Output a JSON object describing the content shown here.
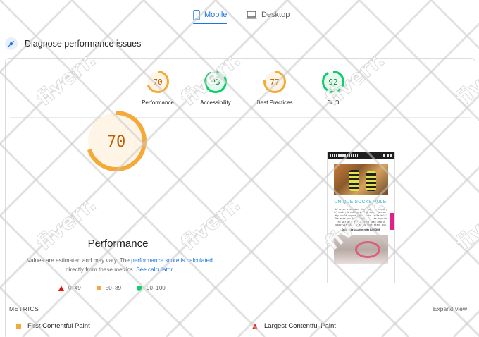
{
  "tabs": [
    {
      "label": "Mobile",
      "icon": "phone-icon",
      "active": true
    },
    {
      "label": "Desktop",
      "icon": "laptop-icon",
      "active": false
    }
  ],
  "diagnose": {
    "title": "Diagnose performance issues",
    "icon": "diagnose-icon"
  },
  "scores": [
    {
      "label": "Performance",
      "value": 70,
      "color": "#f4a938",
      "bg": "#fff5e6"
    },
    {
      "label": "Accessibility",
      "value": 93,
      "color": "#0cce6b",
      "bg": "#e6f9ee"
    },
    {
      "label": "Best Practices",
      "value": 77,
      "color": "#f4a938",
      "bg": "#fff5e6"
    },
    {
      "label": "SEO",
      "value": 92,
      "color": "#0cce6b",
      "bg": "#e6f9ee"
    }
  ],
  "main": {
    "score": 70,
    "title": "Performance",
    "note_part1": "Values are estimated and may vary. The ",
    "note_link1": "performance score is calculated",
    "note_part2": " directly from these metrics. ",
    "note_link2": "See calculator."
  },
  "legend": [
    {
      "label": "0–49",
      "shape": "triangle",
      "color": "#eb0f00"
    },
    {
      "label": "50–89",
      "shape": "square",
      "color": "#f4a938"
    },
    {
      "label": "90–100",
      "shape": "circle",
      "color": "#0cce6b"
    }
  ],
  "preview": {
    "heading": "UNIQUE SOCKS RULE!",
    "body": "We're on a mission changing the history of socks, breaking boring socks forever. Why would anyone want socks to be dull? The more you know about it, the happier the world! Our aim is to make people happy with quirky socks that stand out.",
    "strong": "Dare to be Different with LAMOOS"
  },
  "metrics": {
    "title": "METRICS",
    "expand": "Expand view",
    "items": [
      {
        "label": "First Contentful Paint",
        "shape": "square",
        "color": "#f4a938"
      },
      {
        "label": "Largest Contentful Paint",
        "shape": "triangle",
        "color": "#eb0f00"
      }
    ]
  },
  "watermark": "fiverr."
}
